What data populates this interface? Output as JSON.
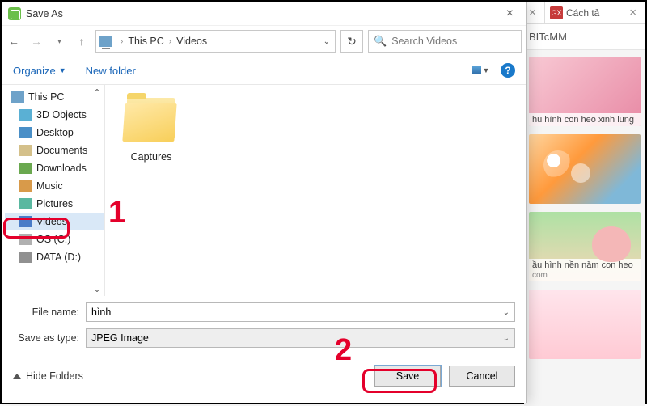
{
  "bg": {
    "tab_close": "×",
    "tab_badge": "GX",
    "tab_label": "Cách tả",
    "omnibox_text": "BITcMM",
    "thumb1_caption": "hu hình con heo xinh lung",
    "thumb3_caption": "ầu hình nền năm con heo",
    "thumb3_sub": "com"
  },
  "dialog": {
    "title": "Save As",
    "close": "×",
    "path": {
      "root": "This PC",
      "folder": "Videos"
    },
    "search_placeholder": "Search Videos",
    "refresh": "↻",
    "toolbar": {
      "organize": "Organize",
      "newfolder": "New folder",
      "help": "?"
    },
    "tree": {
      "thispc": "This PC",
      "objects3d": "3D Objects",
      "desktop": "Desktop",
      "documents": "Documents",
      "downloads": "Downloads",
      "music": "Music",
      "pictures": "Pictures",
      "videos": "Videos",
      "os": "OS (C:)",
      "data": "DATA (D:)"
    },
    "folder_name": "Captures",
    "file_name_label": "File name:",
    "file_name_value": "hình",
    "save_type_label": "Save as type:",
    "save_type_value": "JPEG Image",
    "hide_folders": "Hide Folders",
    "save": "Save",
    "cancel": "Cancel"
  },
  "annotations": {
    "one": "1",
    "two": "2"
  }
}
